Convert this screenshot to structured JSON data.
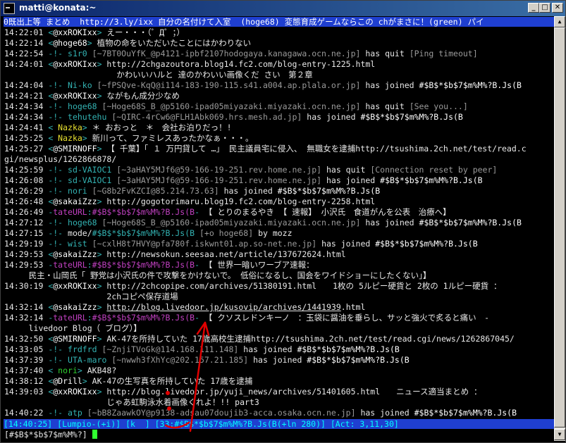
{
  "window": {
    "title": "matti@konata:~",
    "minimize": "_",
    "maximize": "□",
    "close": "✕"
  },
  "topic": "0既出上等 まとめ  http://3.ly/ixx 自分の名付けて入室  (hoge68) 変態育成ゲームならこの chがまさに！(green) パイ",
  "log": [
    [
      [
        "ts",
        "14:22:01 "
      ],
      [
        "s-cyan",
        "<"
      ],
      [
        "s-white",
        "@xxROKIxx"
      ],
      [
        "s-cyan",
        "> "
      ],
      [
        "",
        "えー・・・（゜Д゜；）"
      ]
    ],
    [
      [
        "ts",
        "14:22:14 "
      ],
      [
        "s-cyan",
        "<"
      ],
      [
        "s-white",
        "@hoge68"
      ],
      [
        "s-cyan",
        "> "
      ],
      [
        "",
        "植物の命をいただいたことにはかわりない"
      ]
    ],
    [
      [
        "ts",
        "14:22:54 "
      ],
      [
        "s-cyan",
        "-!- "
      ],
      [
        "s-cyan",
        "s1r0 "
      ],
      [
        "s-grey",
        "[~7BT0OuYfK_@p4121-ipbf2107hodogaya.kanagawa.ocn.ne.jp]"
      ],
      [
        "",
        " has quit "
      ],
      [
        "s-grey",
        "[Ping timeout]"
      ]
    ],
    [
      [
        "ts",
        "14:24:01 "
      ],
      [
        "s-cyan",
        "<"
      ],
      [
        "s-white",
        "@xxROKIxx"
      ],
      [
        "s-cyan",
        "> "
      ],
      [
        "",
        "http://2chgazoutora.blog14.fc2.com/blog-entry-1225.html"
      ]
    ],
    [
      [
        "",
        "                       かわいいハルと 達のかわいい画像くだ さい　第２章"
      ]
    ],
    [
      [
        "ts",
        "14:24:04 "
      ],
      [
        "s-cyan",
        "-!- "
      ],
      [
        "s-cyan",
        "Ni-ko "
      ],
      [
        "s-grey",
        "[~fPSQve-KqQ@i114-183-190-115.s41.a004.ap.plala.or.jp]"
      ],
      [
        "",
        " has joined "
      ],
      [
        "s-white",
        "#$B$*$b$7$m%M%?B.Js(B"
      ]
    ],
    [
      [
        "ts",
        "14:24:21 "
      ],
      [
        "s-cyan",
        "<"
      ],
      [
        "s-white",
        "@xxROKIxx"
      ],
      [
        "s-cyan",
        "> "
      ],
      [
        "",
        "ながもん成分少なめ"
      ]
    ],
    [
      [
        "ts",
        "14:24:34 "
      ],
      [
        "s-cyan",
        "-!- "
      ],
      [
        "s-cyan",
        "hoge68 "
      ],
      [
        "s-grey",
        "[~Hoge68S_B_@p5160-ipad05miyazaki.miyazaki.ocn.ne.jp]"
      ],
      [
        "",
        " has quit "
      ],
      [
        "s-grey",
        "[See you...]"
      ]
    ],
    [
      [
        "ts",
        "14:24:34 "
      ],
      [
        "s-cyan",
        "-!- "
      ],
      [
        "s-cyan",
        "tehutehu "
      ],
      [
        "s-grey",
        "[~QIRC-4rCw6@FLH1Abk069.hrs.mesh.ad.jp]"
      ],
      [
        "",
        " has joined "
      ],
      [
        "s-white",
        "#$B$*$b$7$m%M%?B.Js(B"
      ]
    ],
    [
      [
        "ts",
        "14:24:41 "
      ],
      [
        "s-cyan",
        "< "
      ],
      [
        "s-yel",
        "Nazka"
      ],
      [
        "s-cyan",
        "> "
      ],
      [
        "",
        "＊ おおっと　＊　会社お泊りだっ！!"
      ]
    ],
    [
      [
        "ts",
        "14:25:25 "
      ],
      [
        "s-cyan",
        "< "
      ],
      [
        "s-yel",
        "Nazka"
      ],
      [
        "s-cyan",
        "> "
      ],
      [
        "",
        "新川って、ファミレスあったかなぁ・・・。"
      ]
    ],
    [
      [
        "ts",
        "14:25:27 "
      ],
      [
        "s-cyan",
        "<"
      ],
      [
        "s-white",
        "@SMIRNOFF"
      ],
      [
        "s-cyan",
        "> "
      ],
      [
        "",
        "【 千葉】「 １ 万円貸して …」 民主議員宅に侵入、 無職女を逮捕http://tsushima.2ch.net/test/read.c"
      ]
    ],
    [
      [
        "",
        "gi/newsplus/1262866878/"
      ]
    ],
    [
      [
        "ts",
        "14:25:59 "
      ],
      [
        "s-cyan",
        "-!- "
      ],
      [
        "s-cyan",
        "sd-VAIOC1 "
      ],
      [
        "s-grey",
        "[~3aHAY5MJf6@59-166-19-251.rev.home.ne.jp]"
      ],
      [
        "",
        " has quit "
      ],
      [
        "s-grey",
        "[Connection reset by peer]"
      ]
    ],
    [
      [
        "ts",
        "14:26:08 "
      ],
      [
        "s-cyan",
        "-!- "
      ],
      [
        "s-cyan",
        "sd-VAIOC1 "
      ],
      [
        "s-grey",
        "[~3aHAY5MJf6@59-166-19-251.rev.home.ne.jp]"
      ],
      [
        "",
        " has joined "
      ],
      [
        "s-white",
        "#$B$*$b$7$m%M%?B.Js(B"
      ]
    ],
    [
      [
        "ts",
        "14:26:29 "
      ],
      [
        "s-cyan",
        "-!- "
      ],
      [
        "s-cyan",
        "nori "
      ],
      [
        "s-grey",
        "[~G8b2FvKZCI@85.214.73.63]"
      ],
      [
        "",
        " has joined "
      ],
      [
        "s-white",
        "#$B$*$b$7$m%M%?B.Js(B"
      ]
    ],
    [
      [
        "ts",
        "14:26:48 "
      ],
      [
        "s-cyan",
        "<"
      ],
      [
        "s-white",
        "@sakaiZzz"
      ],
      [
        "s-cyan",
        "> "
      ],
      [
        "",
        "http://gogotorimaru.blog19.fc2.com/blog-entry-2258.html"
      ]
    ],
    [
      [
        "ts",
        "14:26:49 "
      ],
      [
        "s-cyan",
        "-"
      ],
      [
        "s-mag",
        "tateURL"
      ],
      [
        "s-cyan",
        ":"
      ],
      [
        "s-mag",
        "#$B$*$b$7$m%M%?B.Js(B"
      ],
      [
        "s-cyan",
        "- "
      ],
      [
        "",
        "【 とりのまるやき 【 速報】 小沢氏　食道がんを公表　治療へ】"
      ]
    ],
    [
      [
        "ts",
        "14:27:12 "
      ],
      [
        "s-cyan",
        "-!- "
      ],
      [
        "s-cyan",
        "hoge68 "
      ],
      [
        "s-grey",
        "[~Hoge68S_B_@p5160-ipad05miyazaki.miyazaki.ocn.ne.jp]"
      ],
      [
        "",
        " has joined "
      ],
      [
        "s-white",
        "#$B$*$b$7$m%M%?B.Js(B"
      ]
    ],
    [
      [
        "ts",
        "14:27:15 "
      ],
      [
        "s-cyan",
        "-!- "
      ],
      [
        "",
        "mode/"
      ],
      [
        "s-cyan",
        "#$B$*$b$7$m%M%?B.Js(B "
      ],
      [
        "s-grey",
        "[+o hoge68]"
      ],
      [
        "",
        " by mozz"
      ]
    ],
    [
      [
        "ts",
        "14:29:19 "
      ],
      [
        "s-cyan",
        "-!- "
      ],
      [
        "s-cyan",
        "wist "
      ],
      [
        "s-grey",
        "[~cxlH8t7HVY@pfa780f.iskwnt01.ap.so-net.ne.jp]"
      ],
      [
        "",
        " has joined "
      ],
      [
        "s-white",
        "#$B$*$b$7$m%M%?B.Js(B"
      ]
    ],
    [
      [
        "ts",
        "14:29:53 "
      ],
      [
        "s-cyan",
        "<"
      ],
      [
        "s-white",
        "@sakaiZzz"
      ],
      [
        "s-cyan",
        "> "
      ],
      [
        "",
        "http://newsokun.seesaa.net/article/137672624.html"
      ]
    ],
    [
      [
        "ts",
        "14:29:53 "
      ],
      [
        "s-cyan",
        "-"
      ],
      [
        "s-mag",
        "tateURL"
      ],
      [
        "s-cyan",
        ":"
      ],
      [
        "s-mag",
        "#$B$*$b$7$m%M%?B.Js(B"
      ],
      [
        "s-cyan",
        "- "
      ],
      [
        "",
        "【 世界一暗いワーブア速報："
      ]
    ],
    [
      [
        "",
        "     民主・山岡氏「 野党は小沢氏の件で攻撃をかけないで。 低俗になるし、国会をワイドショーにしたくない」】"
      ]
    ],
    [
      [
        "ts",
        "14:30:19 "
      ],
      [
        "s-cyan",
        "<"
      ],
      [
        "s-white",
        "@xxROKIxx"
      ],
      [
        "s-cyan",
        "> "
      ],
      [
        "",
        "http://2chcopipe.com/archives/51380191.html　　1枚の 5ルピー硬貨と 2枚の 1ルピー硬貨 ："
      ]
    ],
    [
      [
        "",
        "                     2chコピペ保存道場"
      ]
    ],
    [
      [
        "ts",
        "14:32:14 "
      ],
      [
        "s-cyan",
        "<"
      ],
      [
        "s-white",
        "@sakaiZzz"
      ],
      [
        "s-cyan",
        "> "
      ],
      [
        "u",
        "http://blog.livedoor.jp/kusovip/archives/1441939"
      ],
      [
        "",
        ".html"
      ]
    ],
    [
      [
        "ts",
        "14:32:14 "
      ],
      [
        "s-cyan",
        "-"
      ],
      [
        "s-mag",
        "tateURL"
      ],
      [
        "s-cyan",
        ":"
      ],
      [
        "s-mag",
        "#$B$*$b$7$m%M%?B.Js(B"
      ],
      [
        "s-cyan",
        "- "
      ],
      [
        "",
        "【 クソスレドンキーノ　：玉袋に醤油を垂らし、サッと強火で炙ると痛い　-"
      ]
    ],
    [
      [
        "",
        "     livedoor Blog（ ブログ）】"
      ]
    ],
    [
      [
        "ts",
        "14:32:50 "
      ],
      [
        "s-cyan",
        "<"
      ],
      [
        "s-white",
        "@SMIRNOFF"
      ],
      [
        "s-cyan",
        "> "
      ],
      [
        "",
        "AK-47を所持していた 17歳高校生逮捕http://tsushima.2ch.net/test/read.cgi/news/1262867045/"
      ]
    ],
    [
      [
        "ts",
        "14:33:05 "
      ],
      [
        "s-cyan",
        "-!- "
      ],
      [
        "s-cyan",
        "frdfrd "
      ],
      [
        "s-grey",
        "[~ZnjiTVoGk@114.168.111.148]"
      ],
      [
        "",
        " has joined "
      ],
      [
        "s-white",
        "#$B$*$b$7$m%M%?B.Js(B"
      ]
    ],
    [
      [
        "ts",
        "14:37:39 "
      ],
      [
        "s-cyan",
        "-!- "
      ],
      [
        "s-cyan",
        "UTA-maro "
      ],
      [
        "s-grey",
        "[~nwwh3fXhYc@202.157.21.185]"
      ],
      [
        "",
        " has joined "
      ],
      [
        "s-white",
        "#$B$*$b$7$m%M%?B.Js(B"
      ]
    ],
    [
      [
        "ts",
        "14:37:40 "
      ],
      [
        "s-cyan",
        "< "
      ],
      [
        "s-green",
        "nori"
      ],
      [
        "s-cyan",
        "> "
      ],
      [
        "",
        "AKB48?"
      ]
    ],
    [
      [
        "ts",
        "14:38:12 "
      ],
      [
        "s-cyan",
        "<"
      ],
      [
        "s-white",
        "@Drill"
      ],
      [
        "s-cyan",
        "> "
      ],
      [
        "",
        "AK-47の生写真を所持していた 17歳を逮捕"
      ]
    ],
    [
      [
        "ts",
        "14:39:03 "
      ],
      [
        "s-cyan",
        "<"
      ],
      [
        "s-white",
        "@xxROKIxx"
      ],
      [
        "s-cyan",
        "> "
      ],
      [
        "",
        "http://blog.livedoor.jp/yuji_news/archives/51401605.html　　ニュース適当まとめ ："
      ]
    ],
    [
      [
        "",
        "                     じゃあ虹駒泳水着画像くれよ！!! part3"
      ]
    ],
    [
      [
        "ts",
        "14:40:22 "
      ],
      [
        "s-cyan",
        "-!- "
      ],
      [
        "s-cyan",
        "atp "
      ],
      [
        "s-grey",
        "[~bB8ZaawkOY@p9138-adsau07doujib3-acca.osaka.ocn.ne.jp]"
      ],
      [
        "",
        " has joined "
      ],
      [
        "s-white",
        "#$B$*$b$7$m%M%?B.Js(B"
      ]
    ]
  ],
  "status_line": "[14:40:25] [Lumpio-(+i)] [k  ] [33:#$B$*$b$7$m%M%?B.Js(B(+ln 280)] [Act: 3,11,30]",
  "input_line": "[#$B$*$b$7$m%M%?]"
}
